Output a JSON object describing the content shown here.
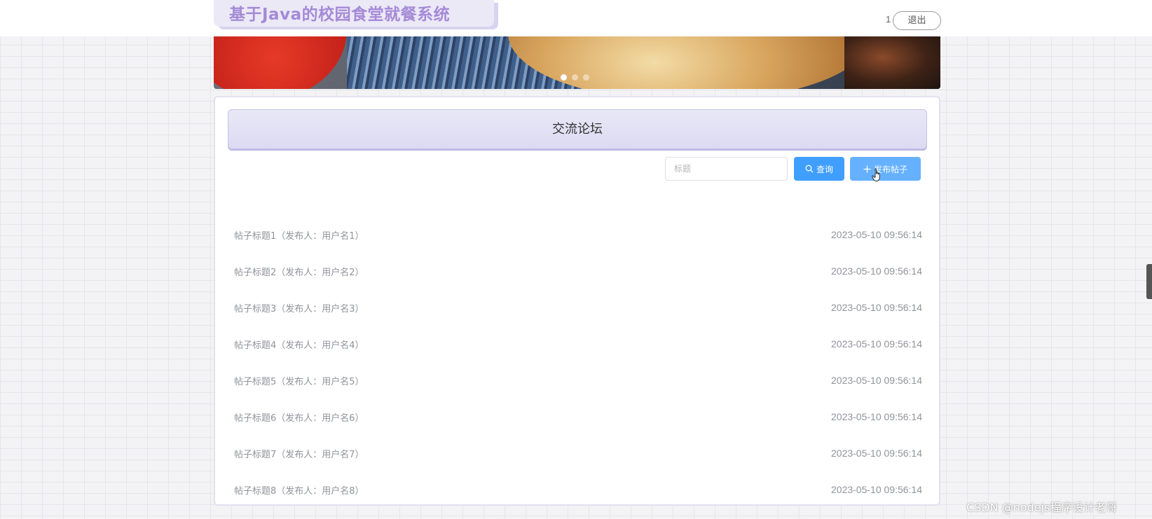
{
  "header": {
    "site_title": "基于Java的校园食堂就餐系统",
    "user_name": "1",
    "logout_label": "退出"
  },
  "banner": {
    "slides": 3,
    "active_slide": 1
  },
  "forum": {
    "section_title": "交流论坛",
    "search_placeholder": "标题",
    "search_value": "",
    "query_label": "查询",
    "post_label": "发布帖子",
    "posts": [
      {
        "title": "帖子标题1（发布人：用户名1）",
        "time": "2023-05-10 09:56:14"
      },
      {
        "title": "帖子标题2（发布人：用户名2）",
        "time": "2023-05-10 09:56:14"
      },
      {
        "title": "帖子标题3（发布人：用户名3）",
        "time": "2023-05-10 09:56:14"
      },
      {
        "title": "帖子标题4（发布人：用户名4）",
        "time": "2023-05-10 09:56:14"
      },
      {
        "title": "帖子标题5（发布人：用户名5）",
        "time": "2023-05-10 09:56:14"
      },
      {
        "title": "帖子标题6（发布人：用户名6）",
        "time": "2023-05-10 09:56:14"
      },
      {
        "title": "帖子标题7（发布人：用户名7）",
        "time": "2023-05-10 09:56:14"
      },
      {
        "title": "帖子标题8（发布人：用户名8）",
        "time": "2023-05-10 09:56:14"
      }
    ]
  },
  "watermark": "CSDN @nodejs程序设计老哥",
  "colors": {
    "primary": "#409eff",
    "primary_light": "#66b1ff",
    "title": "#a48ad6",
    "header_bg": "#dcdaf2"
  },
  "icons": {
    "query": "search-icon",
    "post": "plus-icon"
  }
}
